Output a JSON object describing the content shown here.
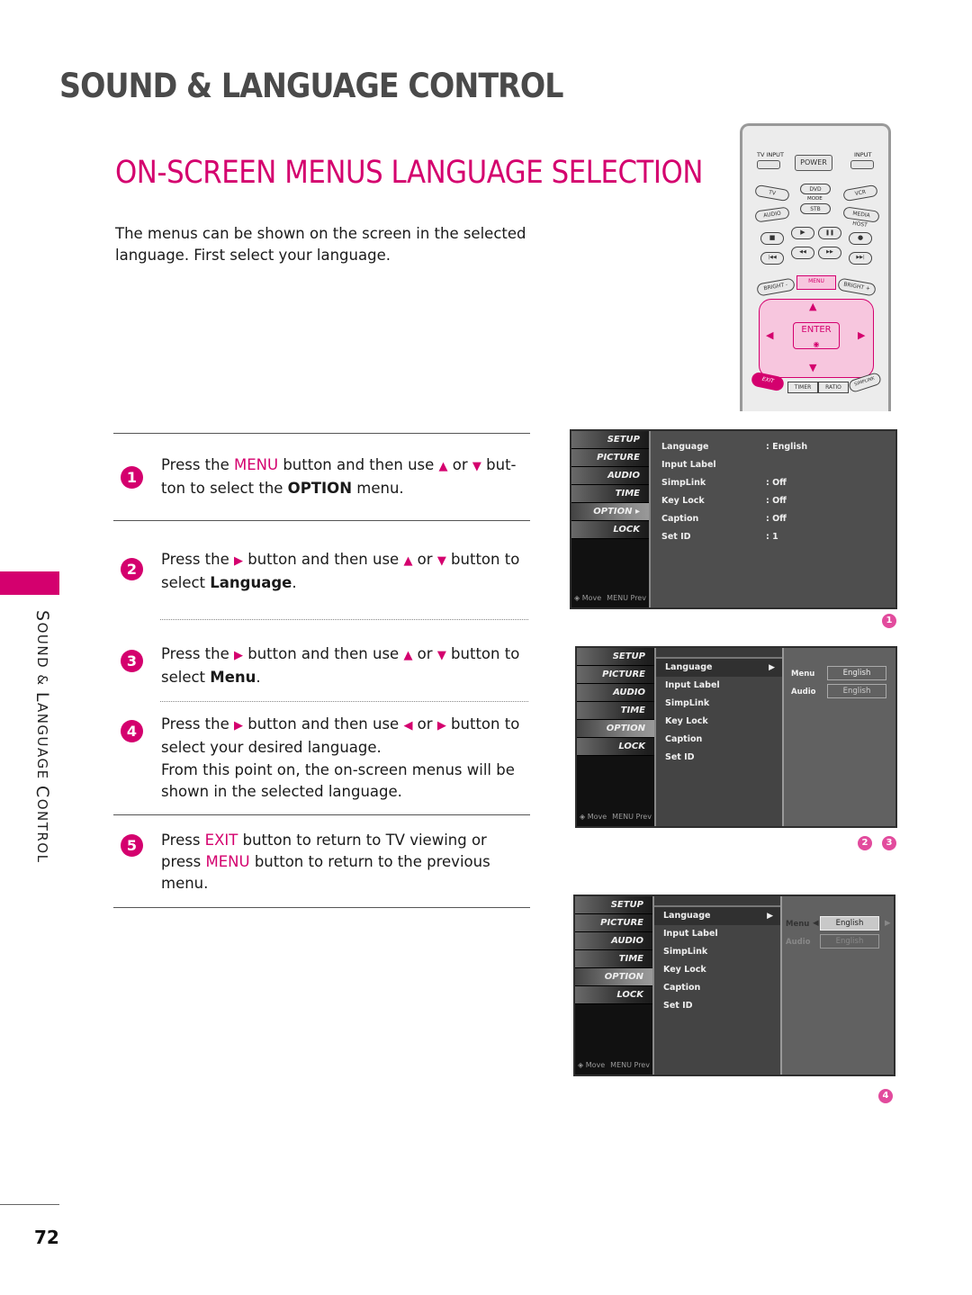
{
  "header": {
    "title": "SOUND & LANGUAGE CONTROL",
    "subtitle": "ON-SCREEN MENUS  LANGUAGE SELECTION",
    "intro": "The menus can be shown on the screen in the selected language. First select your language."
  },
  "sidebar": {
    "section_label_1": "S",
    "section_label_2": "OUND & ",
    "section_label_3": "L",
    "section_label_4": "ANGUAGE ",
    "section_label_5": "C",
    "section_label_6": "ONTROL"
  },
  "page_number": "72",
  "colors": {
    "accent": "#d4006e",
    "title_gray": "#4a4a4a"
  },
  "steps": [
    {
      "num": "1",
      "parts": [
        "Press the ",
        "MENU",
        " button and then use ",
        "▲",
        " or ",
        "▼",
        " but- ton to select the ",
        "OPTION",
        " menu."
      ]
    },
    {
      "num": "2",
      "parts": [
        "Press the ",
        "▶",
        " button and then use ",
        "▲",
        " or ",
        "▼",
        " button to select ",
        "Language",
        "."
      ]
    },
    {
      "num": "3",
      "parts": [
        "Press the ",
        "▶",
        " button and then use ",
        "▲",
        " or ",
        "▼",
        " button to select ",
        "Menu",
        "."
      ]
    },
    {
      "num": "4",
      "parts": [
        "Press the ",
        "▶",
        " button and then use  ",
        "◀",
        " or ",
        "▶",
        " button to select your desired language."
      ],
      "note": "From this point on, the on-screen menus will be shown in the selected language."
    },
    {
      "num": "5",
      "parts": [
        "Press ",
        "EXIT",
        " button to return to TV viewing or press ",
        "MENU",
        " button to return to the previous menu."
      ]
    }
  ],
  "tv_menu": {
    "categories": [
      "SETUP",
      "PICTURE",
      "AUDIO",
      "TIME",
      "OPTION ▸",
      "LOCK"
    ],
    "categories_plain": [
      "SETUP",
      "PICTURE",
      "AUDIO",
      "TIME",
      "OPTION",
      "LOCK"
    ],
    "nav_move": "◈ Move",
    "nav_prev": "MENU Prev",
    "items": [
      {
        "label": "Language",
        "value": ": English"
      },
      {
        "label": "Input Label",
        "value": ""
      },
      {
        "label": "SimpLink",
        "value": ": Off"
      },
      {
        "label": "Key Lock",
        "value": ": Off"
      },
      {
        "label": "Caption",
        "value": ": Off"
      },
      {
        "label": "Set ID",
        "value": ": 1"
      }
    ],
    "submenu_arrow": "▶",
    "language_options": [
      {
        "label": "Menu",
        "value": "English"
      },
      {
        "label": "Audio",
        "value": "English"
      }
    ],
    "left_arrow": "◀",
    "right_arrow": "▶"
  },
  "figure_badges": {
    "fig1": "1",
    "fig2a": "2",
    "fig2b": "3",
    "fig3": "4"
  },
  "remote": {
    "tv_input": "TV INPUT",
    "input": "INPUT",
    "power": "POWER",
    "tv": "TV",
    "dvd": "DVD",
    "vcr": "VCR",
    "mode": "MODE",
    "audio": "AUDIO",
    "stb": "STB",
    "media_host": "MEDIA HOST",
    "stop": "■",
    "play": "▶",
    "pause": "❚❚",
    "rec": "●",
    "prev": "|◀◀",
    "rew": "◀◀",
    "ff": "▶▶",
    "next": "▶▶|",
    "bright_minus": "BRIGHT -",
    "menu": "MENU",
    "bright_plus": "BRIGHT +",
    "up": "▲",
    "down": "▼",
    "left": "◀",
    "right": "▶",
    "enter": "ENTER",
    "exit": "EXIT",
    "timer": "TIMER",
    "ratio": "RATIO",
    "simplink": "SIMPLINK"
  }
}
